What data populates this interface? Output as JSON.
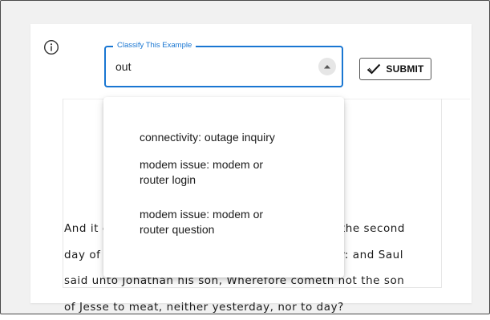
{
  "classifier": {
    "field_label": "Classify This Example",
    "input_value": "out",
    "submit_label": "SUBMIT"
  },
  "passage": {
    "lines": [
      " And it came to pass on the morrow, which was the second",
      "day of the month, that David's place was empty: and Saul",
      "said unto Jonathan his son, Wherefore cometh not the son",
      "of Jesse to meat, neither yesterday, nor to day?"
    ]
  },
  "dropdown": {
    "options": [
      {
        "label": "connectivity: outage inquiry"
      },
      {
        "label": "modem issue: modem or router login"
      },
      {
        "label": "modem issue: modem or router question"
      }
    ]
  },
  "colors": {
    "accent": "#1976d2",
    "page_background": "#f1f1f1",
    "card_background": "#ffffff"
  },
  "icons": {
    "info": "info-circle-icon",
    "toggle": "caret-up-icon",
    "submit": "checkmark-icon"
  }
}
